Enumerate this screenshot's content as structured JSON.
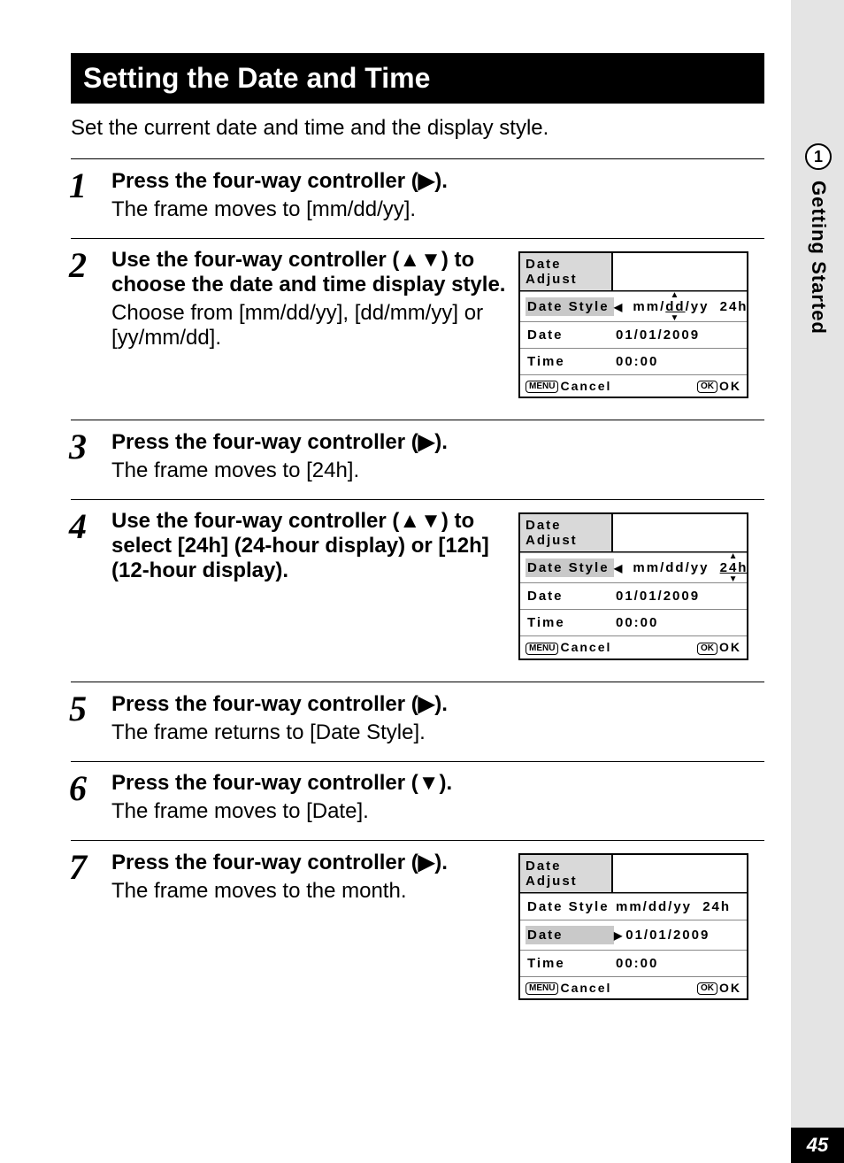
{
  "sideTab": {
    "number": "1",
    "label": "Getting Started"
  },
  "pageNumber": "45",
  "heading": "Setting the Date and Time",
  "intro": "Set the current date and time and the display style.",
  "steps": {
    "s1": {
      "num": "1",
      "title": "Press the four-way controller (▶).",
      "desc": "The frame moves to [mm/dd/yy]."
    },
    "s2": {
      "num": "2",
      "title": "Use the four-way controller (▲▼) to choose the date and time display style.",
      "desc": "Choose from [mm/dd/yy], [dd/mm/yy] or [yy/mm/dd]."
    },
    "s3": {
      "num": "3",
      "title": "Press the four-way controller (▶).",
      "desc": "The frame moves to [24h]."
    },
    "s4": {
      "num": "4",
      "title": "Use the four-way controller (▲▼) to select [24h] (24-hour display) or [12h] (12-hour display).",
      "desc": ""
    },
    "s5": {
      "num": "5",
      "title": "Press the four-way controller (▶).",
      "desc": "The frame returns to [Date Style]."
    },
    "s6": {
      "num": "6",
      "title": "Press the four-way controller (▼).",
      "desc": "The frame moves to [Date]."
    },
    "s7": {
      "num": "7",
      "title": "Press the four-way controller (▶).",
      "desc": "The frame moves to the month."
    }
  },
  "lcd": {
    "title": "Date Adjust",
    "dateStyleLabel": "Date Style",
    "dateLabel": "Date",
    "timeLabel": "Time",
    "dateStyleValue": "mm/dd/yy",
    "dateStyleHour": "24h",
    "dateValue": "01/01/2009",
    "timeValue": "00:00",
    "menuBtn": "MENU",
    "okBtn": "OK",
    "cancel": "Cancel",
    "ok": "OK"
  }
}
